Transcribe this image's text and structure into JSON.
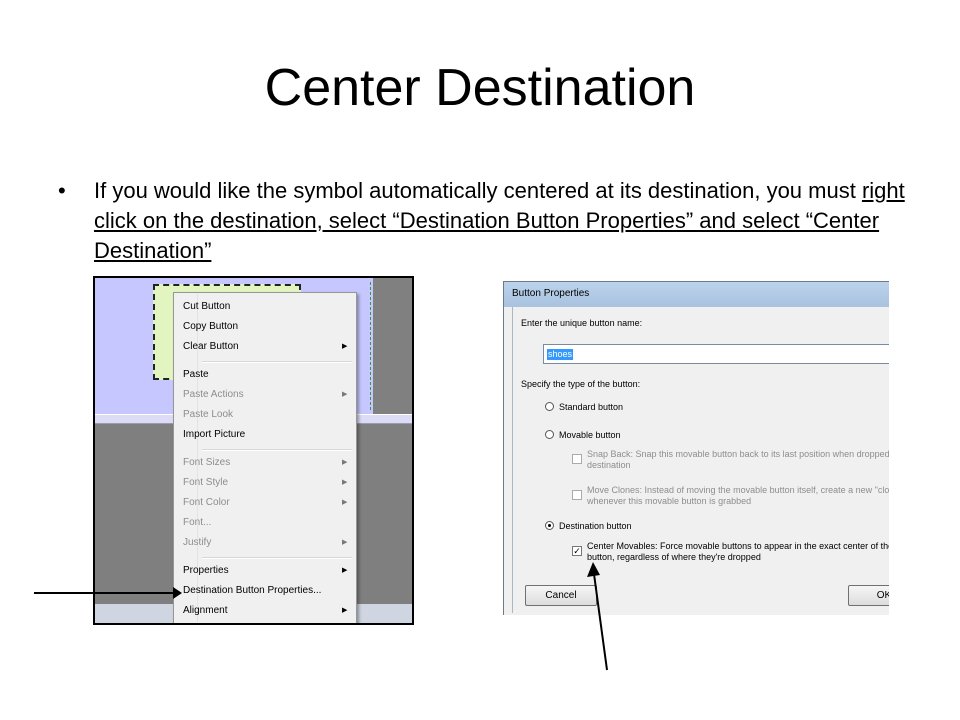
{
  "slide": {
    "title": "Center Destination",
    "bullet_marker": "•",
    "bullet_plain": "If you would like the symbol automatically centered at its destination, you must ",
    "bullet_underlined": "right click on the destination, select “Destination Button Properties” and select “Center Destination”"
  },
  "context_menu": {
    "items": [
      {
        "label": "Cut Button",
        "enabled": true,
        "submenu": false
      },
      {
        "label": "Copy Button",
        "enabled": true,
        "submenu": false
      },
      {
        "label": "Clear Button",
        "enabled": true,
        "submenu": true
      },
      {
        "label": "Paste",
        "enabled": true,
        "submenu": false
      },
      {
        "label": "Paste Actions",
        "enabled": false,
        "submenu": true
      },
      {
        "label": "Paste Look",
        "enabled": false,
        "submenu": false
      },
      {
        "label": "Import Picture",
        "enabled": true,
        "submenu": false
      },
      {
        "label": "Font Sizes",
        "enabled": false,
        "submenu": true
      },
      {
        "label": "Font Style",
        "enabled": false,
        "submenu": true
      },
      {
        "label": "Font Color",
        "enabled": false,
        "submenu": true
      },
      {
        "label": "Font...",
        "enabled": false,
        "submenu": false
      },
      {
        "label": "Justify",
        "enabled": false,
        "submenu": true
      },
      {
        "label": "Properties",
        "enabled": true,
        "submenu": true
      },
      {
        "label": "Destination Button Properties...",
        "enabled": true,
        "submenu": false
      },
      {
        "label": "Alignment",
        "enabled": true,
        "submenu": true
      }
    ]
  },
  "dialog": {
    "title": "Button Properties",
    "name_prompt": "Enter the unique button name:",
    "name_value": "shoes",
    "type_prompt": "Specify the type of the button:",
    "standard_label": "Standard button",
    "movable_label": "Movable button",
    "snap_back_line1": "Snap Back: Snap this movable button back to its last position when dropped on an",
    "snap_back_line2": "destination",
    "move_clones_line1": "Move Clones: Instead of moving the movable button itself, create a new \"cloned\" c",
    "move_clones_line2": "whenever this movable button is grabbed",
    "destination_label": "Destination button",
    "center_line1": "Center Movables: Force movable buttons to appear in the exact center of the desti",
    "center_line2": "button, regardless of where they're dropped",
    "center_checked": true,
    "selected_type": "Destination button",
    "cancel_label": "Cancel",
    "ok_label": "OK"
  }
}
